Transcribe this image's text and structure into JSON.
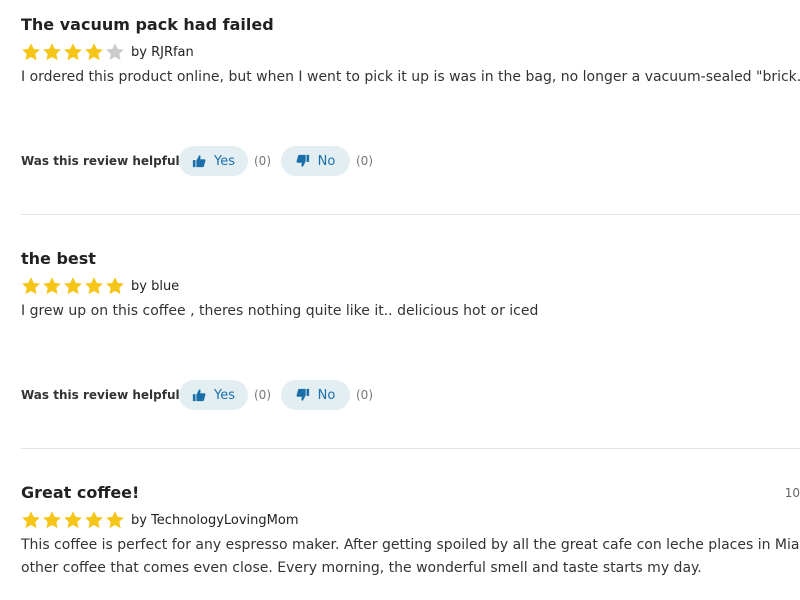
{
  "helpful_prompt": "Was this review helpful?",
  "yes_label": "Yes",
  "no_label": "No",
  "colors": {
    "star_filled": "#f5c518",
    "star_empty": "#cccccc",
    "button_bg": "#e3eef3",
    "button_text": "#1a6fa8",
    "divider": "#e5e5e5"
  },
  "reviews": [
    {
      "title": "The vacuum pack had failed",
      "rating": 4,
      "max_rating": 5,
      "byline": "by RJRfan",
      "body_lines": [
        "I ordered this product online, but when I went to pick it up is was in the bag, no longer a vacuum-sealed \"brick.\""
      ],
      "yes_count": "(0)",
      "no_count": "(0)",
      "side_date": ""
    },
    {
      "title": "the best",
      "rating": 5,
      "max_rating": 5,
      "byline": "by blue",
      "body_lines": [
        "I grew up on this coffee , theres nothing quite like it.. delicious hot or iced"
      ],
      "yes_count": "(0)",
      "no_count": "(0)",
      "side_date": ""
    },
    {
      "title": "Great coffee!",
      "rating": 5,
      "max_rating": 5,
      "byline": "by TechnologyLovingMom",
      "body_lines": [
        "This coffee is perfect for any espresso maker. After getting spoiled by all the great cafe con leche places in Miami, there",
        "other coffee that comes even close. Every morning, the wonderful smell and taste starts my day."
      ],
      "yes_count": "",
      "no_count": "",
      "side_date": "10"
    }
  ]
}
